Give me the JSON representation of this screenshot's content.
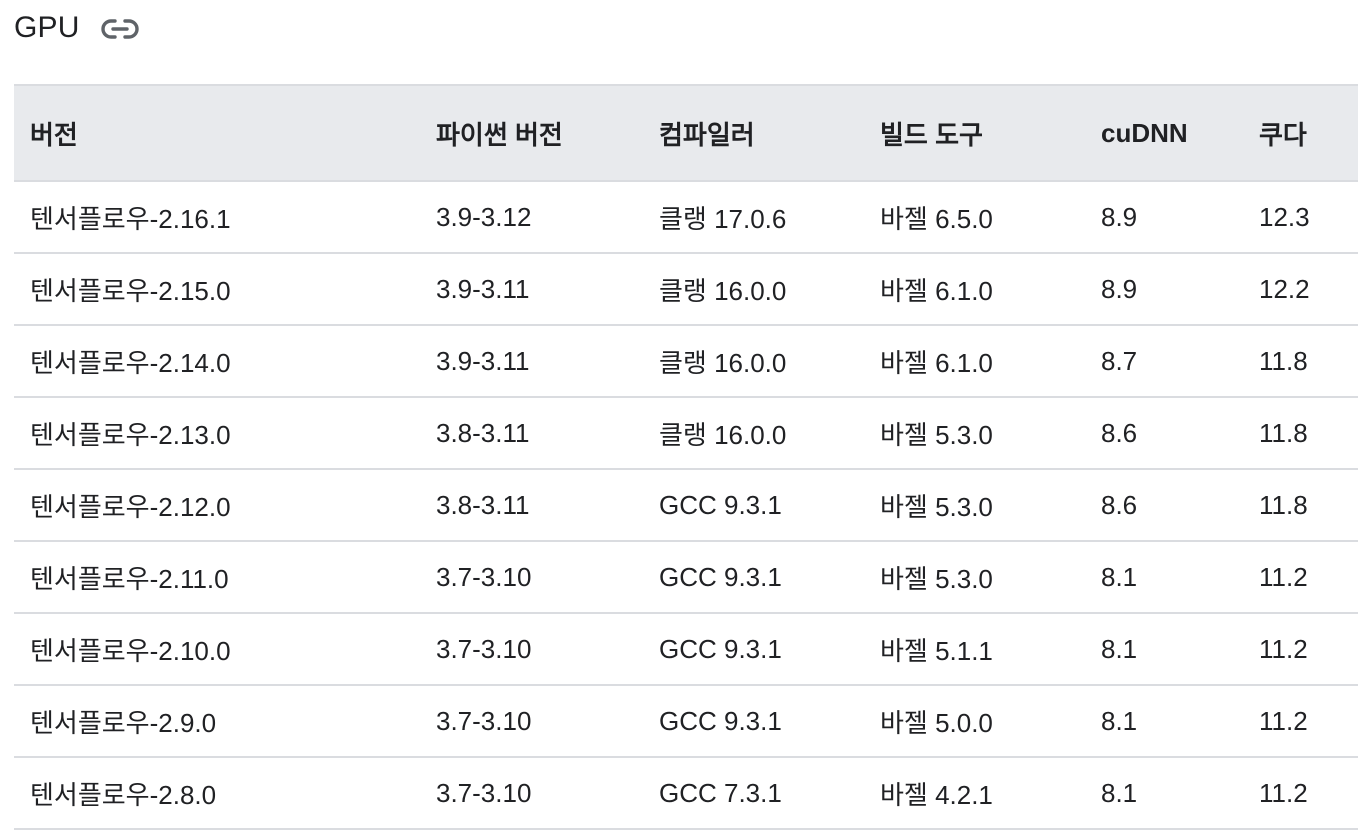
{
  "section": {
    "title": "GPU",
    "link_icon": "link-icon"
  },
  "table": {
    "headers": [
      "버전",
      "파이썬 버전",
      "컴파일러",
      "빌드 도구",
      "cuDNN",
      "쿠다"
    ],
    "rows": [
      [
        "텐서플로우-2.16.1",
        "3.9-3.12",
        "클랭 17.0.6",
        "바젤 6.5.0",
        "8.9",
        "12.3"
      ],
      [
        "텐서플로우-2.15.0",
        "3.9-3.11",
        "클랭 16.0.0",
        "바젤 6.1.0",
        "8.9",
        "12.2"
      ],
      [
        "텐서플로우-2.14.0",
        "3.9-3.11",
        "클랭 16.0.0",
        "바젤 6.1.0",
        "8.7",
        "11.8"
      ],
      [
        "텐서플로우-2.13.0",
        "3.8-3.11",
        "클랭 16.0.0",
        "바젤 5.3.0",
        "8.6",
        "11.8"
      ],
      [
        "텐서플로우-2.12.0",
        "3.8-3.11",
        "GCC 9.3.1",
        "바젤 5.3.0",
        "8.6",
        "11.8"
      ],
      [
        "텐서플로우-2.11.0",
        "3.7-3.10",
        "GCC 9.3.1",
        "바젤 5.3.0",
        "8.1",
        "11.2"
      ],
      [
        "텐서플로우-2.10.0",
        "3.7-3.10",
        "GCC 9.3.1",
        "바젤 5.1.1",
        "8.1",
        "11.2"
      ],
      [
        "텐서플로우-2.9.0",
        "3.7-3.10",
        "GCC 9.3.1",
        "바젤 5.0.0",
        "8.1",
        "11.2"
      ],
      [
        "텐서플로우-2.8.0",
        "3.7-3.10",
        "GCC 7.3.1",
        "바젤 4.2.1",
        "8.1",
        "11.2"
      ]
    ]
  }
}
